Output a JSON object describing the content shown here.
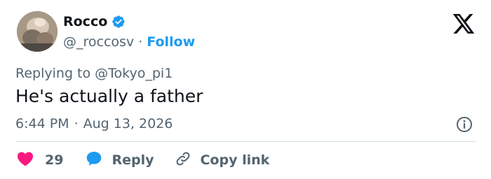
{
  "author": {
    "display_name": "Rocco",
    "handle": "@_roccosv",
    "separator": "·",
    "follow_label": "Follow",
    "verified": true
  },
  "tweet": {
    "replying_prefix": "Replying to",
    "replying_to": "@Tokyo_pi1",
    "text": "He's actually a father",
    "time": "6:44 PM",
    "separator": "·",
    "date": "Aug 13, 2026"
  },
  "actions": {
    "likes_count": "29",
    "reply_label": "Reply",
    "copy_link_label": "Copy link"
  },
  "colors": {
    "accent": "#1d9bf0",
    "like": "#f91880",
    "text_primary": "#0f1419",
    "text_secondary": "#536471",
    "divider": "#cfd9de"
  },
  "icons": {
    "brand": "x-logo-icon",
    "verified": "verified-badge-icon",
    "info": "info-icon",
    "like": "heart-icon",
    "reply": "speech-bubble-icon",
    "copy": "link-icon"
  }
}
